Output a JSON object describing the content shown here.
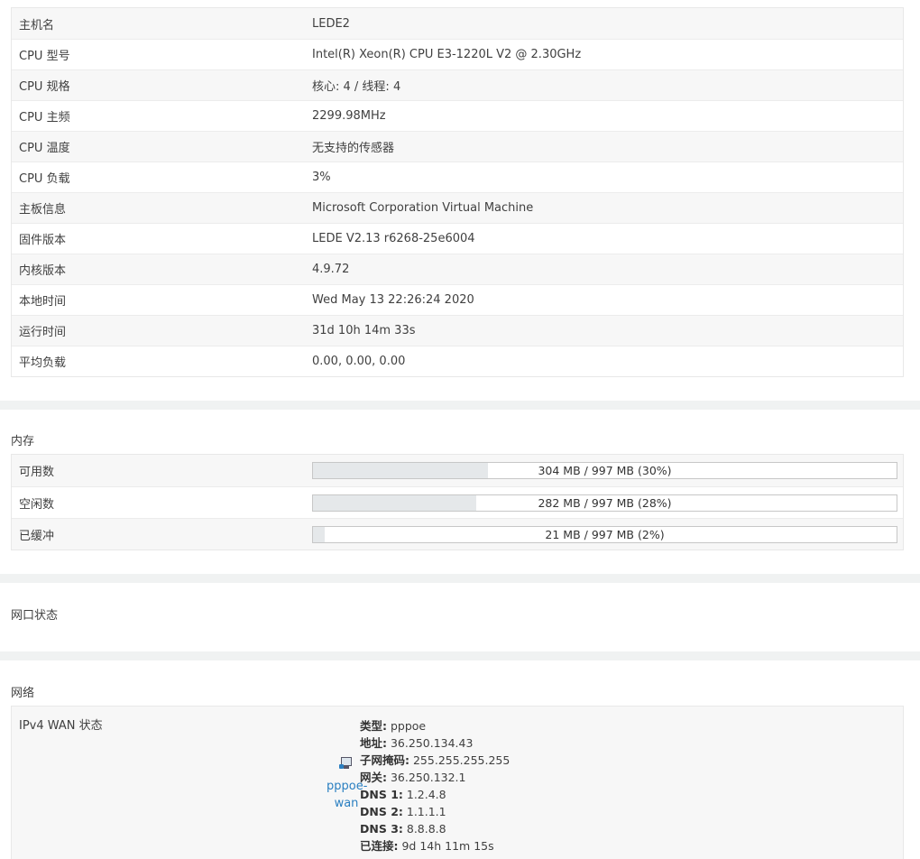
{
  "system": {
    "rows": [
      {
        "label": "主机名",
        "value": "LEDE2"
      },
      {
        "label": "CPU 型号",
        "value": "Intel(R) Xeon(R) CPU E3-1220L V2 @ 2.30GHz"
      },
      {
        "label": "CPU 规格",
        "value": "核心: 4 / 线程: 4"
      },
      {
        "label": "CPU 主频",
        "value": "2299.98MHz"
      },
      {
        "label": "CPU 温度",
        "value": "无支持的传感器"
      },
      {
        "label": "CPU 负载",
        "value": "3%"
      },
      {
        "label": "主板信息",
        "value": "Microsoft Corporation Virtual Machine"
      },
      {
        "label": "固件版本",
        "value": "LEDE V2.13 r6268-25e6004"
      },
      {
        "label": "内核版本",
        "value": "4.9.72"
      },
      {
        "label": "本地时间",
        "value": "Wed May 13 22:26:24 2020"
      },
      {
        "label": "运行时间",
        "value": "31d 10h 14m 33s"
      },
      {
        "label": "平均负载",
        "value": "0.00, 0.00, 0.00"
      }
    ]
  },
  "memory": {
    "title": "内存",
    "rows": [
      {
        "label": "可用数",
        "text": "304 MB / 997 MB (30%)",
        "percent": 30
      },
      {
        "label": "空闲数",
        "text": "282 MB / 997 MB (28%)",
        "percent": 28
      },
      {
        "label": "已缓冲",
        "text": "21 MB / 997 MB (2%)",
        "percent": 2
      }
    ]
  },
  "ports": {
    "title": "网口状态"
  },
  "network": {
    "title": "网络",
    "wan_label": "IPv4 WAN 状态",
    "iface_name": "pppoe-wan",
    "iface_icon": "network-interface-icon",
    "details": [
      {
        "key": "类型:",
        "value": "pppoe"
      },
      {
        "key": "地址:",
        "value": "36.250.134.43"
      },
      {
        "key": "子网掩码:",
        "value": "255.255.255.255"
      },
      {
        "key": "网关:",
        "value": "36.250.132.1"
      },
      {
        "key": "DNS 1:",
        "value": "1.2.4.8"
      },
      {
        "key": "DNS 2:",
        "value": "1.1.1.1"
      },
      {
        "key": "DNS 3:",
        "value": "8.8.8.8"
      },
      {
        "key": "已连接:",
        "value": "9d 14h 11m 15s"
      }
    ]
  }
}
